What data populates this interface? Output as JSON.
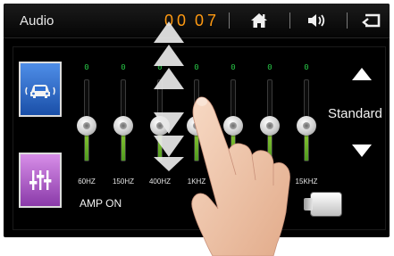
{
  "header": {
    "title": "Audio",
    "clock_hours": "00",
    "clock_minutes": "07"
  },
  "eq": {
    "bands": [
      {
        "value": "0",
        "freq": "60HZ",
        "level": 0.5
      },
      {
        "value": "0",
        "freq": "150HZ",
        "level": 0.5
      },
      {
        "value": "0",
        "freq": "400HZ",
        "level": 0.5
      },
      {
        "value": "0",
        "freq": "1KHZ",
        "level": 0.5
      },
      {
        "value": "0",
        "freq": "",
        "level": 0.5
      },
      {
        "value": "0",
        "freq": "",
        "level": 0.5
      },
      {
        "value": "0",
        "freq": "15KHZ",
        "level": 0.5
      }
    ],
    "preset": "Standard"
  },
  "amp": {
    "label": "AMP ON"
  },
  "colors": {
    "clock": "#ff9a12",
    "eq_value": "#2ad04a",
    "car_button": "#2f6fd0",
    "eq_button": "#b35cd0"
  },
  "icons": {
    "home": "home-icon",
    "volume": "volume-icon",
    "back": "back-icon",
    "car": "car-sound-icon",
    "eq": "equalizer-icon"
  }
}
